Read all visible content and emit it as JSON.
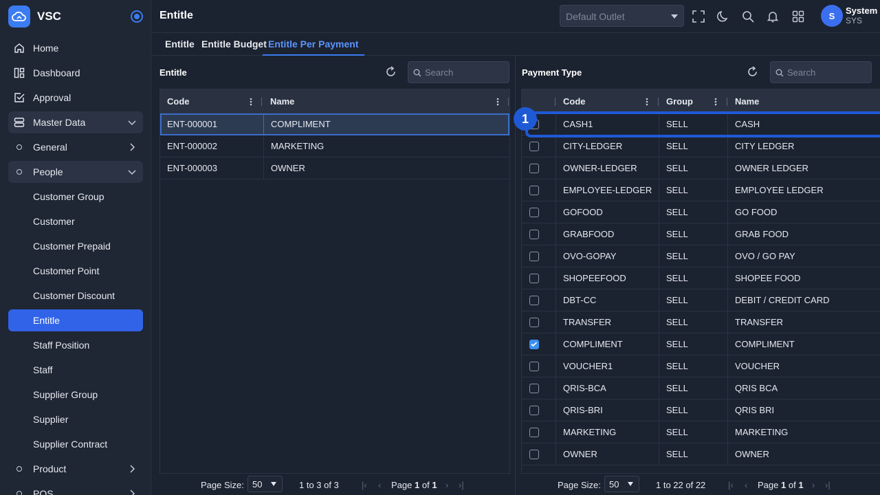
{
  "app": {
    "name": "VSC"
  },
  "sidebar": {
    "items": [
      {
        "label": "Home"
      },
      {
        "label": "Dashboard"
      },
      {
        "label": "Approval"
      },
      {
        "label": "Master Data"
      },
      {
        "label": "General"
      },
      {
        "label": "People"
      },
      {
        "label": "Customer Group"
      },
      {
        "label": "Customer"
      },
      {
        "label": "Customer Prepaid"
      },
      {
        "label": "Customer Point"
      },
      {
        "label": "Customer Discount"
      },
      {
        "label": "Entitle"
      },
      {
        "label": "Staff Position"
      },
      {
        "label": "Staff"
      },
      {
        "label": "Supplier Group"
      },
      {
        "label": "Supplier"
      },
      {
        "label": "Supplier Contract"
      },
      {
        "label": "Product"
      },
      {
        "label": "POS"
      }
    ]
  },
  "header": {
    "title": "Entitle",
    "outlet_placeholder": "Default Outlet",
    "user": {
      "initial": "S",
      "name": "System",
      "code": "SYS"
    }
  },
  "tabs": [
    {
      "label": "Entitle"
    },
    {
      "label": "Entitle Budget"
    },
    {
      "label": "Entitle Per Payment"
    }
  ],
  "left_panel": {
    "title": "Entitle",
    "search_placeholder": "Search",
    "columns": [
      "Code",
      "Name"
    ],
    "rows": [
      {
        "code": "ENT-000001",
        "name": "COMPLIMENT"
      },
      {
        "code": "ENT-000002",
        "name": "MARKETING"
      },
      {
        "code": "ENT-000003",
        "name": "OWNER"
      }
    ],
    "pager": {
      "size_label": "Page Size:",
      "size": "50",
      "range": "1 to 3 of 3",
      "page_word": "Page",
      "page": "1",
      "of_word": "of",
      "total": "1"
    }
  },
  "right_panel": {
    "title": "Payment Type",
    "search_placeholder": "Search",
    "columns": [
      "Code",
      "Group",
      "Name"
    ],
    "rows": [
      {
        "code": "CASH1",
        "group": "SELL",
        "name": "CASH"
      },
      {
        "code": "CITY-LEDGER",
        "group": "SELL",
        "name": "CITY LEDGER"
      },
      {
        "code": "OWNER-LEDGER",
        "group": "SELL",
        "name": "OWNER LEDGER"
      },
      {
        "code": "EMPLOYEE-LEDGER",
        "group": "SELL",
        "name": "EMPLOYEE LEDGER"
      },
      {
        "code": "GOFOOD",
        "group": "SELL",
        "name": "GO FOOD"
      },
      {
        "code": "GRABFOOD",
        "group": "SELL",
        "name": "GRAB FOOD"
      },
      {
        "code": "OVO-GOPAY",
        "group": "SELL",
        "name": "OVO / GO PAY"
      },
      {
        "code": "SHOPEEFOOD",
        "group": "SELL",
        "name": "SHOPEE FOOD"
      },
      {
        "code": "DBT-CC",
        "group": "SELL",
        "name": "DEBIT / CREDIT CARD"
      },
      {
        "code": "TRANSFER",
        "group": "SELL",
        "name": "TRANSFER"
      },
      {
        "code": "COMPLIMENT",
        "group": "SELL",
        "name": "COMPLIMENT"
      },
      {
        "code": "VOUCHER1",
        "group": "SELL",
        "name": "VOUCHER"
      },
      {
        "code": "QRIS-BCA",
        "group": "SELL",
        "name": "QRIS BCA"
      },
      {
        "code": "QRIS-BRI",
        "group": "SELL",
        "name": "QRIS BRI"
      },
      {
        "code": "MARKETING",
        "group": "SELL",
        "name": "MARKETING"
      },
      {
        "code": "OWNER",
        "group": "SELL",
        "name": "OWNER"
      }
    ],
    "pager": {
      "size_label": "Page Size:",
      "size": "50",
      "range": "1 to 22 of 22",
      "page_word": "Page",
      "page": "1",
      "of_word": "of",
      "total": "1"
    }
  },
  "annotation": {
    "number": "1"
  },
  "colors": {
    "accent": "#3b7cf0",
    "active_nav": "#3163e8",
    "annotation": "#1f5ad6"
  }
}
